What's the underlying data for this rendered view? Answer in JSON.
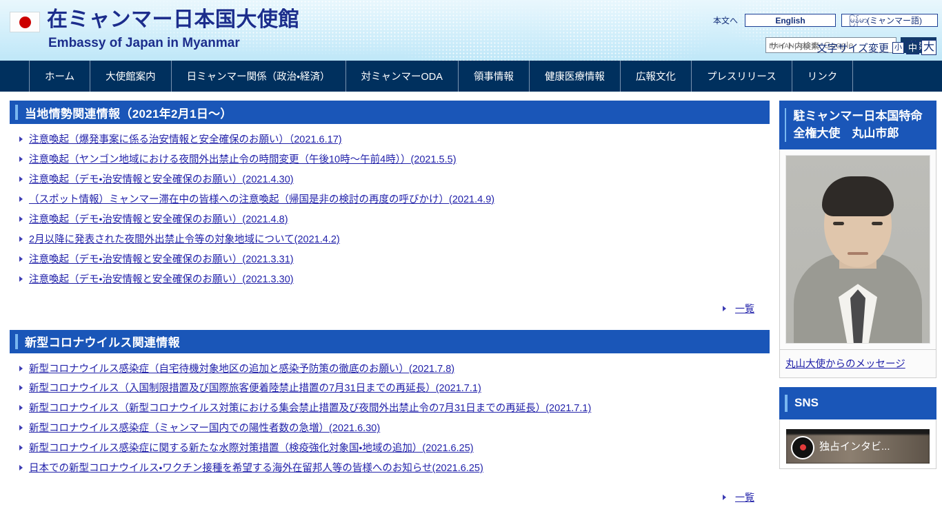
{
  "header": {
    "flag_icon": "japan-flag-icon",
    "site_title": "在ミャンマー日本国大使館",
    "site_subtitle": "Embassy of Japan in Myanmar",
    "skip_link": "本文へ",
    "lang_english": "English",
    "lang_burmese_native": "မြန်မာ",
    "lang_burmese_jp": "(ミャンマー語)",
    "search": {
      "placeholder_jp": "サイト内検索",
      "placeholder_google_prefix": "ENHANCED BY ",
      "placeholder_google": "Google",
      "value": "",
      "button_label": "検索"
    },
    "fontsize": {
      "label": "文字サイズ変更",
      "small": "小",
      "medium": "中",
      "large": "大",
      "selected": "中"
    }
  },
  "nav": {
    "items": [
      {
        "label": "ホーム"
      },
      {
        "label": "大使館案内"
      },
      {
        "label": "日ミャンマー関係（政治・経済）"
      },
      {
        "label": "対ミャンマーODA"
      },
      {
        "label": "領事情報"
      },
      {
        "label": "健康医療情報"
      },
      {
        "label": "広報文化"
      },
      {
        "label": "プレスリリース"
      },
      {
        "label": "リンク"
      }
    ]
  },
  "main": {
    "sections": [
      {
        "title": "当地情勢関連情報（2021年2月1日～）",
        "links": [
          {
            "text": "注意喚起（爆発事案に係る治安情報と安全確保のお願い）（2021.6.17)"
          },
          {
            "text": "注意喚起（ヤンゴン地域における夜間外出禁止令の時間変更（午後10時～午前4時））(2021.5.5)"
          },
          {
            "text": "注意喚起（デモ・治安情報と安全確保のお願い）(2021.4.30)"
          },
          {
            "text": "（スポット情報）ミャンマー滞在中の皆様への注意喚起（帰国是非の検討の再度の呼びかけ）(2021.4.9)"
          },
          {
            "text": "注意喚起（デモ・治安情報と安全確保のお願い）(2021.4.8)"
          },
          {
            "text": "2月以降に発表された夜間外出禁止令等の対象地域について(2021.4.2)"
          },
          {
            "text": "注意喚起（デモ・治安情報と安全確保のお願い）(2021.3.31)"
          },
          {
            "text": "注意喚起（デモ・治安情報と安全確保のお願い）(2021.3.30)"
          }
        ],
        "more_label": "一覧"
      },
      {
        "title": "新型コロナウイルス関連情報",
        "links": [
          {
            "text": "新型コロナウイルス感染症（自宅待機対象地区の追加と感染予防策の徹底のお願い）(2021.7.8)"
          },
          {
            "text": "新型コロナウイルス（入国制限措置及び国際旅客便着陸禁止措置の7月31日までの再延長）(2021.7.1)"
          },
          {
            "text": "新型コロナウイルス（新型コロナウイルス対策における集会禁止措置及び夜間外出禁止令の7月31日までの再延長）(2021.7.1)"
          },
          {
            "text": "新型コロナウイルス感染症（ミャンマー国内での陽性者数の急増）(2021.6.30)"
          },
          {
            "text": "新型コロナウイルス感染症に関する新たな水際対策措置（検疫強化対象国・地域の追加）(2021.6.25)"
          },
          {
            "text": "日本での新型コロナウイルス・ワクチン接種を希望する海外在留邦人等の皆様へのお知らせ(2021.6.25)"
          }
        ],
        "more_label": "一覧"
      }
    ]
  },
  "sidebar": {
    "ambassador": {
      "title": "駐ミャンマー日本国特命全権大使　丸山市郎",
      "photo_alt": "ambassador-portrait",
      "message_link": "丸山大使からのメッセージ"
    },
    "sns": {
      "title": "SNS",
      "video_title": "独占インタビ..."
    }
  },
  "colors": {
    "nav_bg": "#00305e",
    "panel_head_bg": "#1a56b8",
    "panel_accent": "#79b7f0",
    "link": "#2222aa",
    "header_text": "#1c2d8c",
    "flag_red": "#cc0000"
  }
}
